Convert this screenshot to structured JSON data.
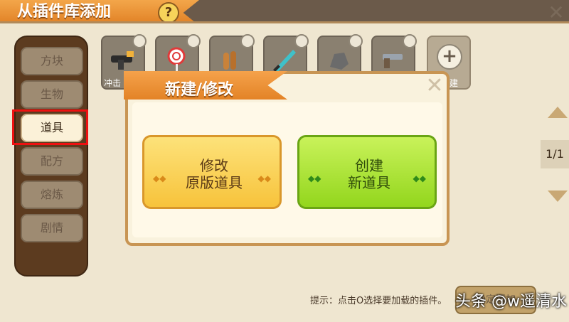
{
  "window": {
    "title": "从插件库添加",
    "help_label": "?",
    "close_label": "✕"
  },
  "sidebar": {
    "items": [
      {
        "label": "方块"
      },
      {
        "label": "生物"
      },
      {
        "label": "道具",
        "active": true
      },
      {
        "label": "配方"
      },
      {
        "label": "熔炼"
      },
      {
        "label": "剧情"
      }
    ]
  },
  "items": [
    {
      "icon": "gun-icon",
      "label": "冲击"
    },
    {
      "icon": "lollipop-icon",
      "label": ""
    },
    {
      "icon": "bullets-icon",
      "label": ""
    },
    {
      "icon": "sword-icon",
      "label": ""
    },
    {
      "icon": "stone-icon",
      "label": ""
    },
    {
      "icon": "pistol-icon",
      "label": ""
    }
  ],
  "add_item": {
    "plus": "+",
    "label": "建"
  },
  "pager": {
    "text": "1/1"
  },
  "hint": {
    "text": "提示：点击O选择要加载的插件。"
  },
  "bottom_button": {
    "label": "确定添加"
  },
  "watermark": {
    "text": "头条 @w遥清水"
  },
  "modal": {
    "title": "新建/修改",
    "close_label": "✕",
    "buttons": [
      {
        "line1": "修改",
        "line2": "原版道具"
      },
      {
        "line1": "创建",
        "line2": "新道具"
      }
    ],
    "deco": "◆◆"
  },
  "colors": {
    "accent_orange": "#e38326",
    "yellow_button": "#f7c33b",
    "green_button": "#93d61d",
    "highlight": "#ee1111"
  }
}
